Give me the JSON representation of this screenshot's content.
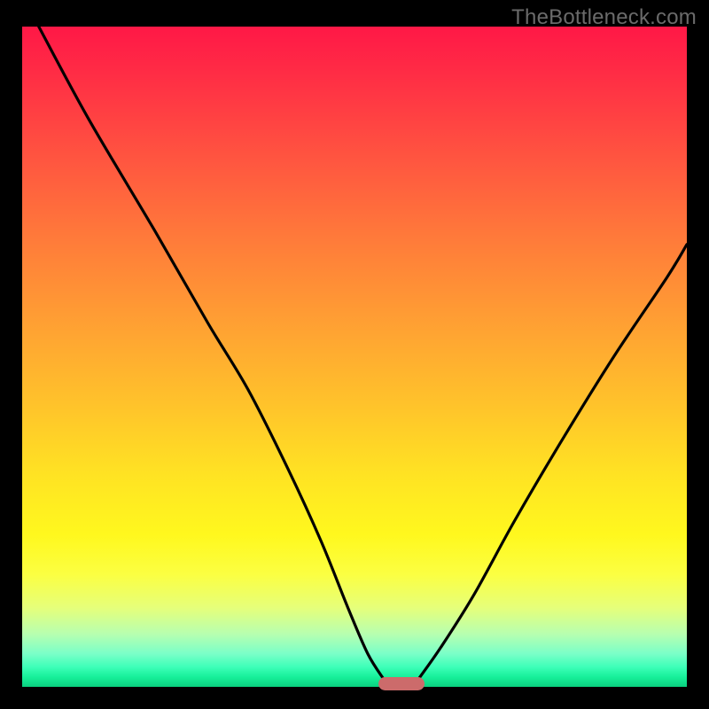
{
  "watermark": {
    "text": "TheBottleneck.com"
  },
  "chart_data": {
    "type": "line",
    "title": "",
    "xlabel": "",
    "ylabel": "",
    "xlim": [
      0,
      100
    ],
    "ylim": [
      0,
      100
    ],
    "grid": false,
    "legend": false,
    "background_gradient": {
      "top_color": "#ff1846",
      "mid_color": "#ffe323",
      "bottom_color": "#0ad07f"
    },
    "series": [
      {
        "name": "left-branch",
        "x": [
          2.5,
          10,
          20,
          28,
          34,
          40,
          45,
          49,
          52,
          54.5
        ],
        "values": [
          100,
          86,
          69,
          55,
          45,
          33,
          22,
          12,
          5,
          1
        ]
      },
      {
        "name": "right-branch",
        "x": [
          59.5,
          63,
          68,
          74,
          81,
          89,
          97,
          100
        ],
        "values": [
          1,
          6,
          14,
          25,
          37,
          50,
          62,
          67
        ]
      }
    ],
    "marker": {
      "name": "bottleneck-range",
      "x_center": 57,
      "y": 0.5,
      "color": "#cc6b6b"
    }
  }
}
